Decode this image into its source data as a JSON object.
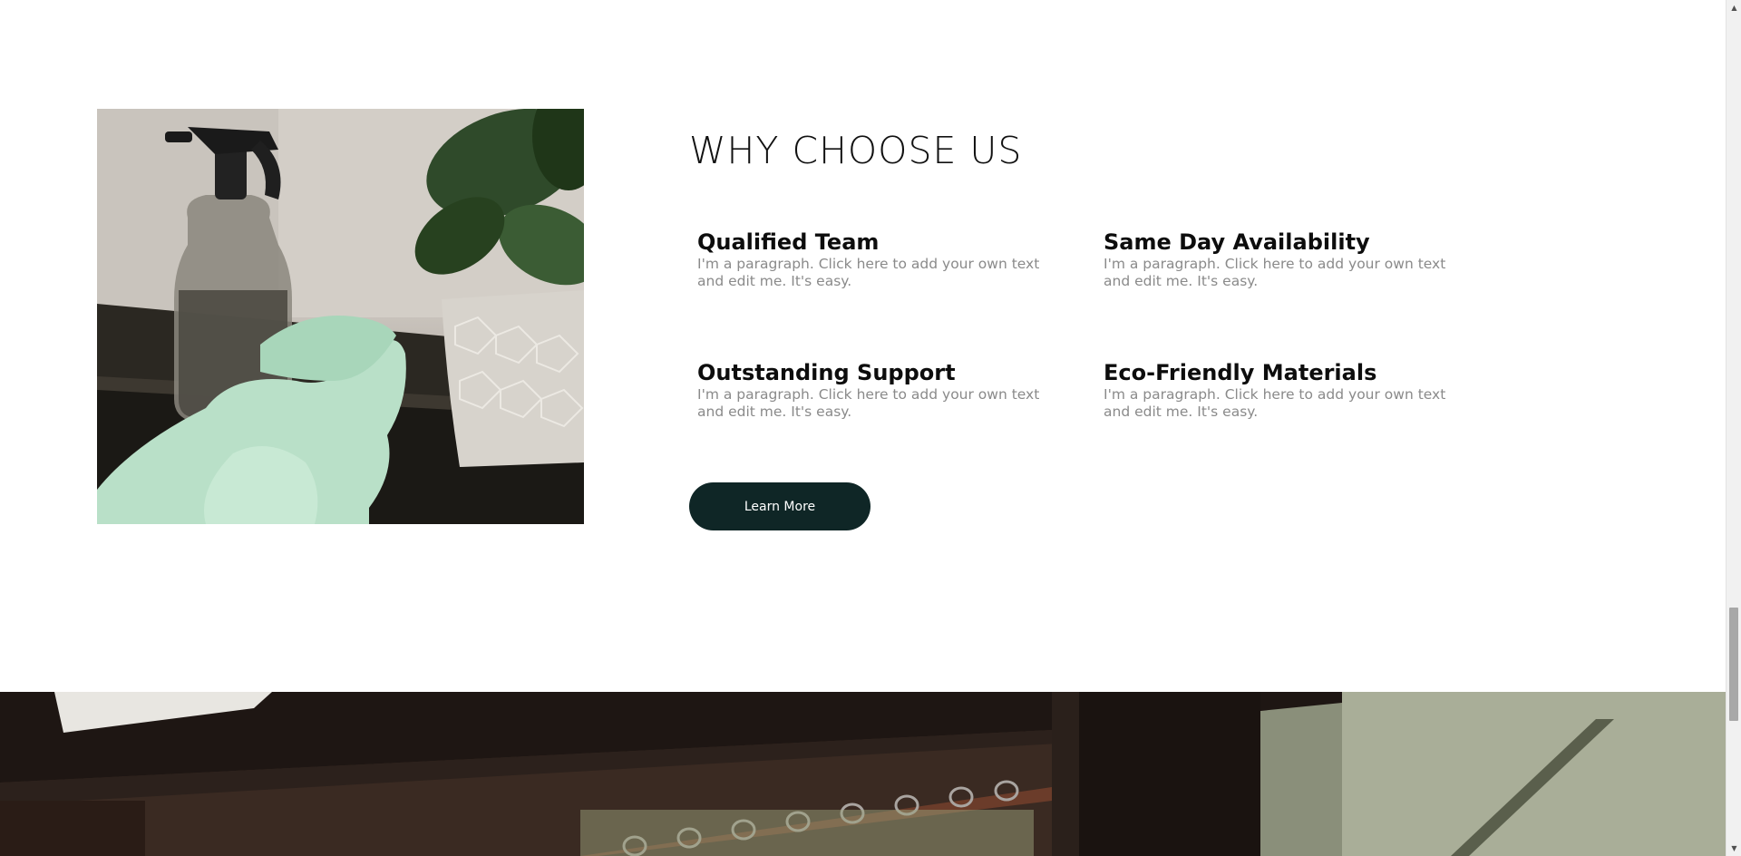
{
  "section": {
    "title": "WHY CHOOSE US",
    "features": [
      {
        "title": "Qualified Team",
        "text": "I'm a paragraph. Click here to add your own text and edit me. It's easy."
      },
      {
        "title": "Same Day Availability",
        "text": "I'm a paragraph. Click here to add your own text and edit me. It's easy."
      },
      {
        "title": "Outstanding Support",
        "text": "I'm a paragraph. Click here to add your own text and edit me. It's easy."
      },
      {
        "title": "Eco-Friendly Materials",
        "text": "I'm a paragraph. Click here to add your own text and edit me. It's easy."
      }
    ],
    "button_label": "Learn More"
  },
  "images": {
    "feature_photo": "spray-bottle-plant-gloves-photo",
    "banner_photo": "closet-rail-hangers-photo"
  },
  "colors": {
    "button_bg": "#0f2626",
    "title_text": "#111111",
    "body_text": "#8a8a8a"
  },
  "scrollbar": {
    "up_icon": "triangle-up-icon",
    "down_icon": "triangle-down-icon"
  }
}
